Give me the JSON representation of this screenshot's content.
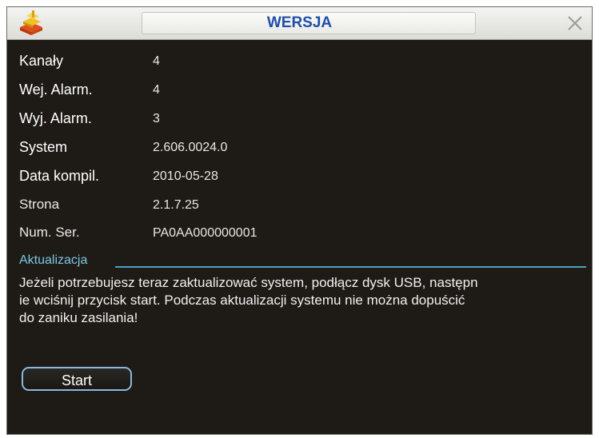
{
  "window": {
    "title": "WERSJA",
    "icons": {
      "app": "app-icon",
      "close": "close-icon"
    }
  },
  "info": {
    "channels": {
      "label": "Kanały",
      "value": "4"
    },
    "alarm_in": {
      "label": "Wej. Alarm.",
      "value": "4"
    },
    "alarm_out": {
      "label": "Wyj. Alarm.",
      "value": "3"
    },
    "system": {
      "label": "System",
      "value": "2.606.0024.0"
    },
    "build_date": {
      "label": "Data kompil.",
      "value": "2010-05-28"
    },
    "web": {
      "label": "Strona",
      "value": "2.1.7.25"
    },
    "serial": {
      "label": "Num. Ser.",
      "value": "PA0AA000000001"
    }
  },
  "update": {
    "section_label": "Aktualizacja",
    "message": "Jeżeli potrzebujesz teraz zaktualizować system, podłącz dysk USB, następn\nie wciśnij przycisk start. Podczas aktualizacji systemu nie można dopuścić\ndo zaniku zasilania!",
    "start_label": "Start"
  },
  "colors": {
    "background": "#1e1b16",
    "title_text": "#1f4fa8",
    "section_accent": "#7ec6e3",
    "button_border": "#8ab7dd"
  }
}
